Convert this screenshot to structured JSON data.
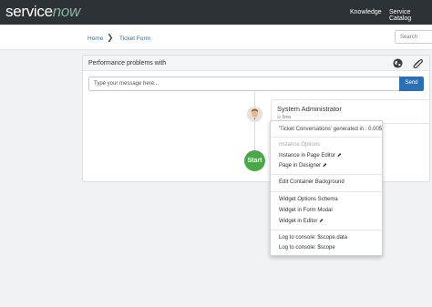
{
  "header": {
    "logo_part1": "service",
    "logo_part2": "now",
    "nav": [
      "Knowledge",
      "Service Catalog"
    ]
  },
  "breadcrumb": {
    "items": [
      "Home",
      "Ticket Form"
    ],
    "separator": "❯"
  },
  "search": {
    "placeholder": "Search"
  },
  "panel": {
    "title": "Performance problems with",
    "icons": [
      "globe-icon",
      "paperclip-icon"
    ],
    "message_placeholder": "Type your message here...",
    "send_label": "Send"
  },
  "timeline": {
    "entry": {
      "author": "System Administrator",
      "time": "⊙ 5mo"
    },
    "start_label": "Start"
  },
  "context_menu": {
    "header": "'Ticket Conversations' generated in : 0.005",
    "section_label": "Instance Options",
    "items": {
      "page_editor": "Instance in Page Editor ⬈",
      "page_designer": "Page in Designer ⬈",
      "container_bg": "Edit Container Background",
      "options_schema": "Widget Options Schema",
      "form_modal": "Widget in Form Modal",
      "widget_editor": "Widget in Editor ⬈",
      "log_data": "Log to console: $scope.data",
      "log_scope": "Log to console: $scope"
    }
  },
  "colors": {
    "topbar": "#2d3236",
    "brand_green": "#81b5a1",
    "send_button": "#2e6fb3",
    "start_badge": "#4aa84a",
    "link": "#2e6ea8"
  }
}
